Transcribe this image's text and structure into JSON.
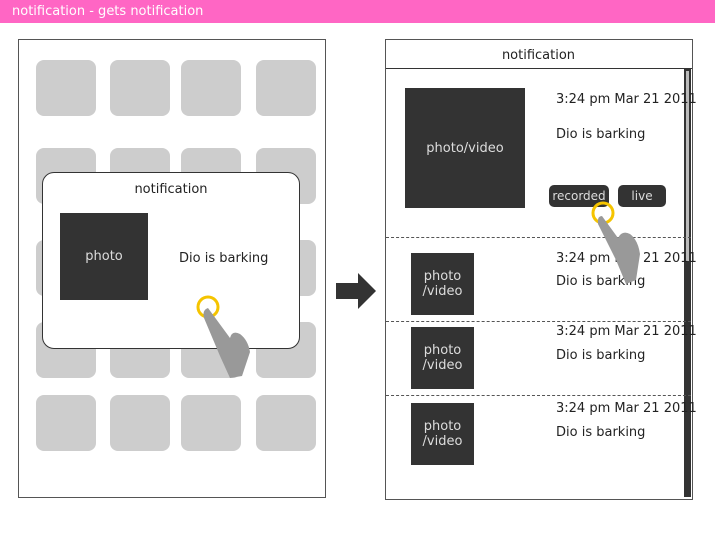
{
  "banner": {
    "title": "notification - gets notification",
    "color": "#ff66c4"
  },
  "left": {
    "popup": {
      "title": "notification",
      "photo": "photo",
      "message": "Dio is barking"
    }
  },
  "right": {
    "header": "notification",
    "items": [
      {
        "media": "photo/video",
        "time": "3:24 pm Mar 21 2011",
        "message": "Dio is barking",
        "buttons": [
          "recorded",
          "live"
        ]
      },
      {
        "media": "photo /video",
        "time": "3:24 pm Mar 21 2011",
        "message": "Dio is barking"
      },
      {
        "media": "photo /video",
        "time": "3:24 pm Mar 21 2011",
        "message": "Dio is barking"
      },
      {
        "media": "photo /video",
        "time": "3:24 pm Mar 21 2011",
        "message": "Dio is barking"
      }
    ]
  }
}
